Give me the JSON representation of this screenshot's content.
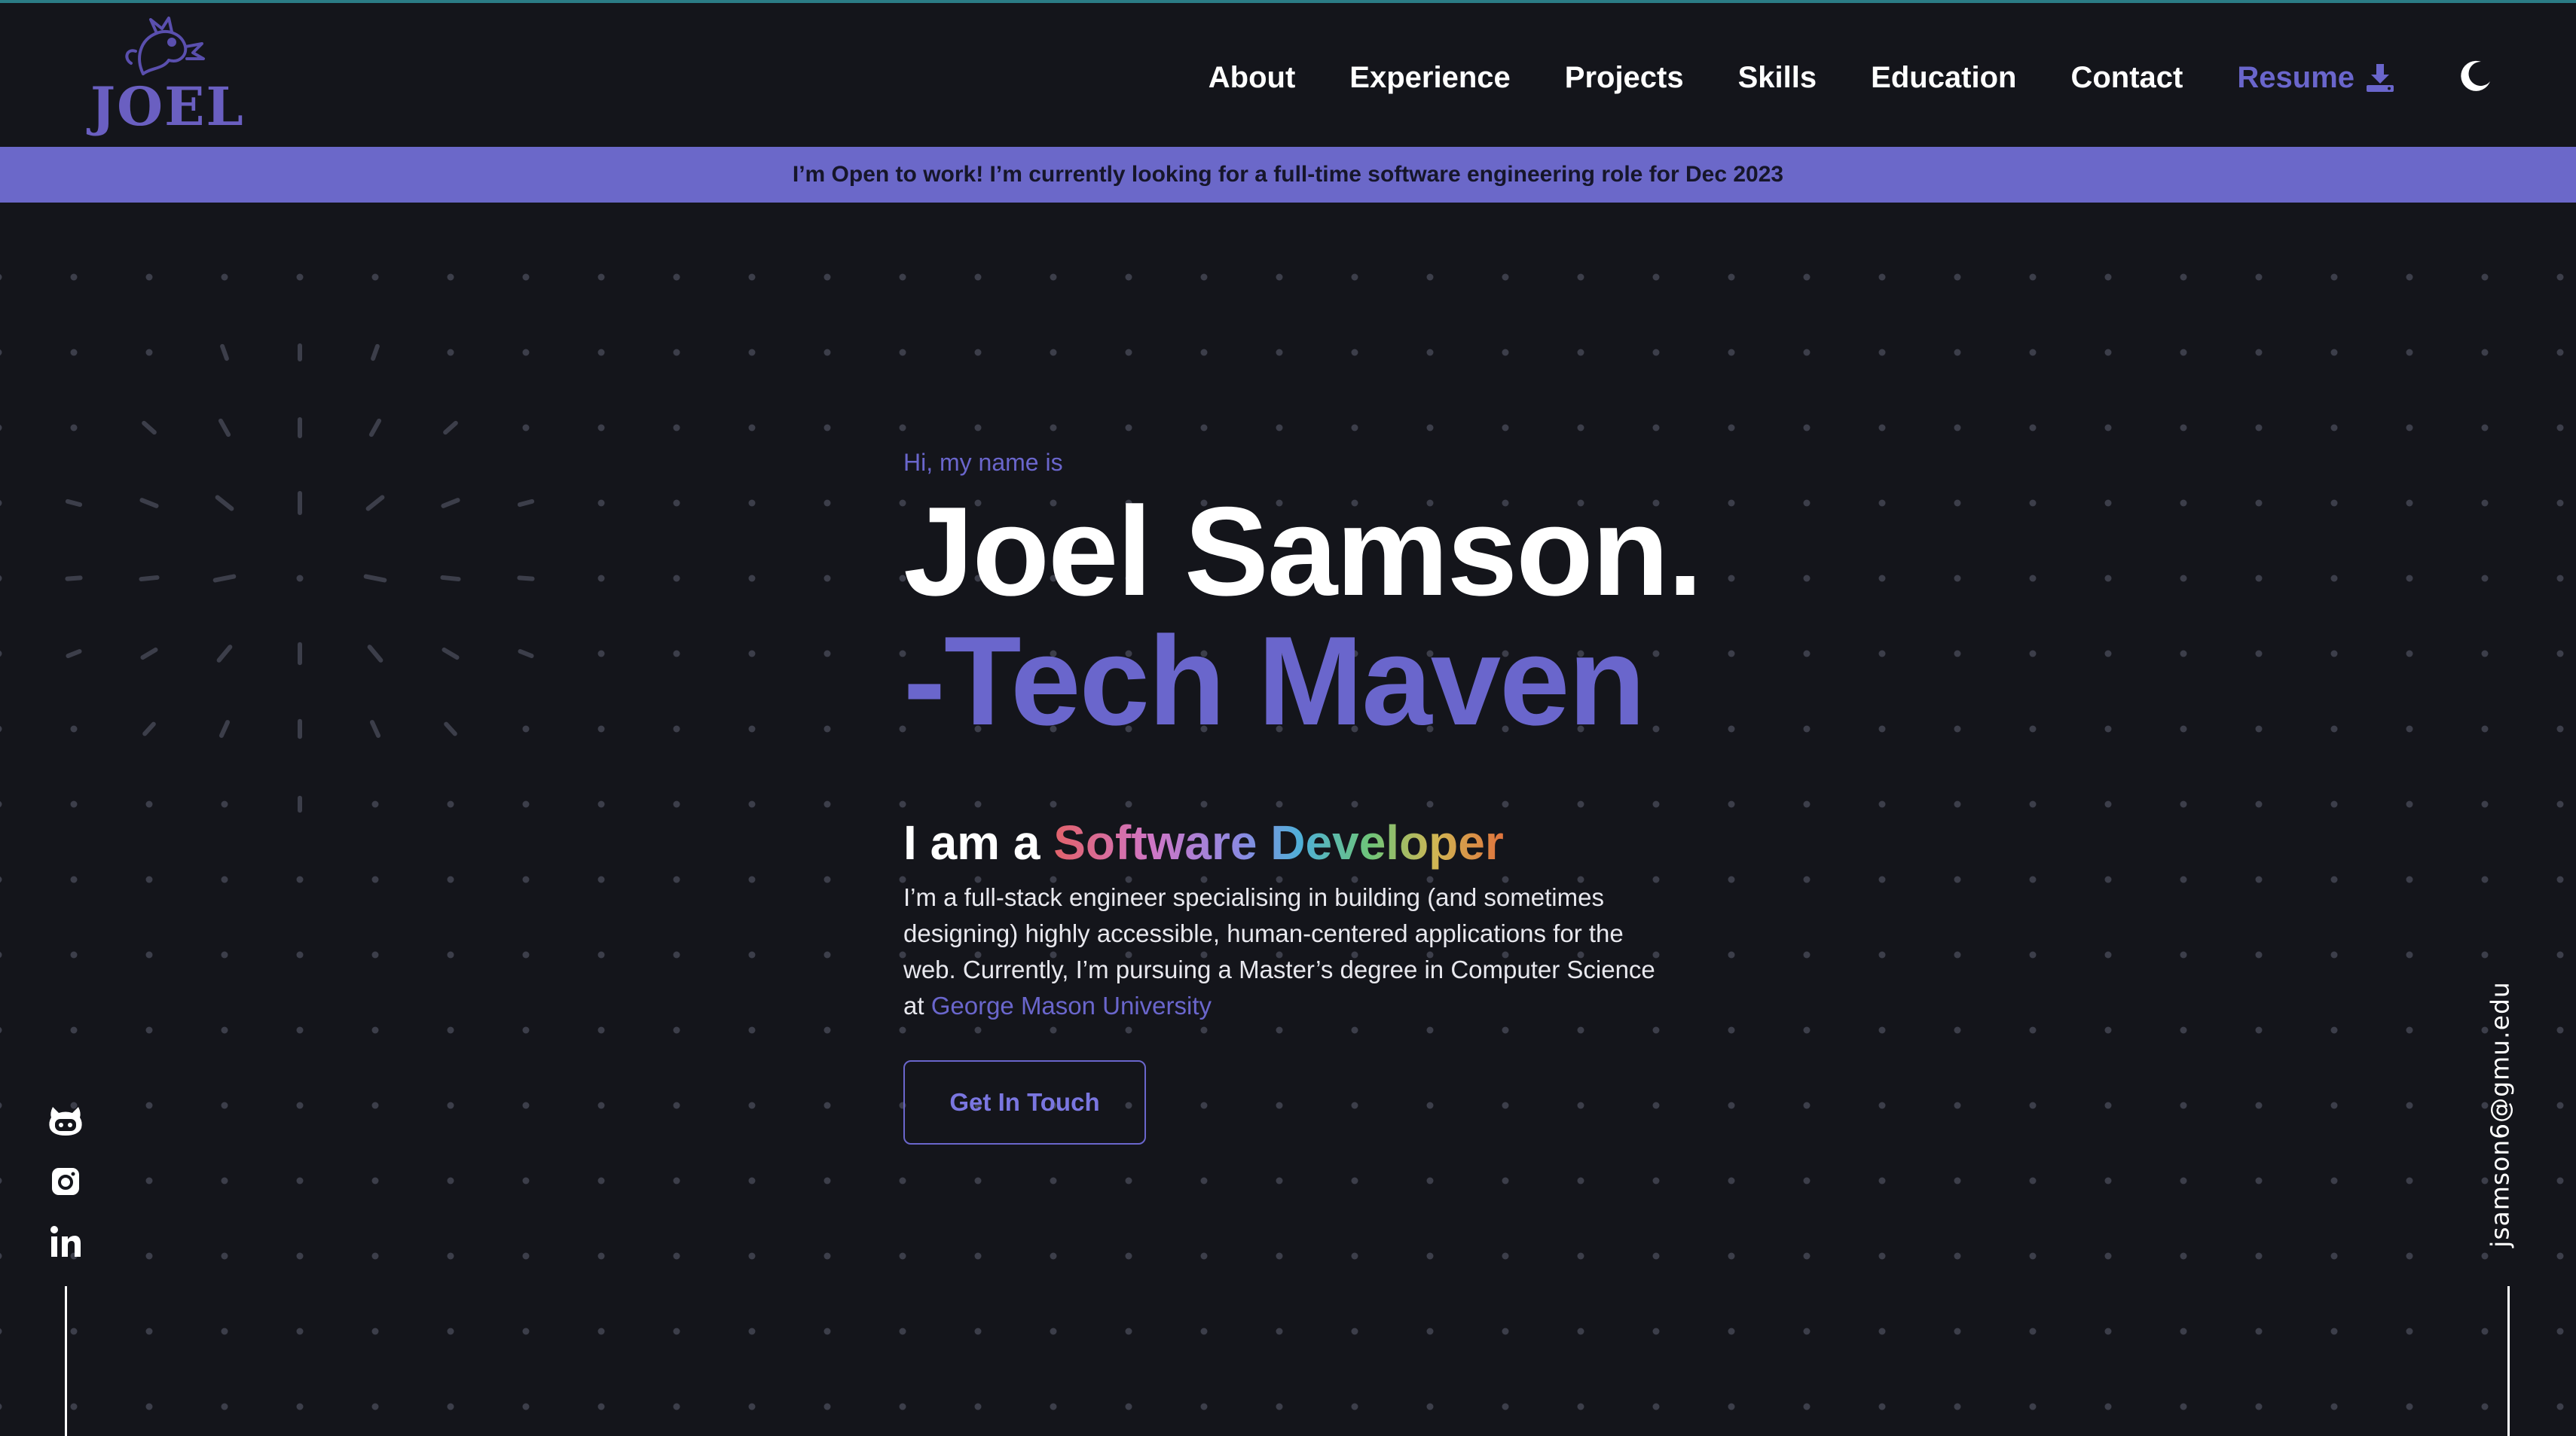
{
  "header": {
    "logo_text": "JOEL",
    "nav": [
      {
        "label": "About"
      },
      {
        "label": "Experience"
      },
      {
        "label": "Projects"
      },
      {
        "label": "Skills"
      },
      {
        "label": "Education"
      },
      {
        "label": "Contact"
      }
    ],
    "resume_label": "Resume",
    "resume_icon": "download-icon",
    "theme_toggle_icon": "moon-icon"
  },
  "banner": {
    "text": "I’m Open to work! I’m currently looking for a full-time software engineering role for Dec 2023"
  },
  "hero": {
    "greeting": "Hi, my name is",
    "name": "Joel Samson.",
    "tagline": "-Tech Maven",
    "role_prefix": "I am a ",
    "role_highlight": "Software Developer",
    "description": "I’m a full-stack engineer specialising in building (and sometimes designing) highly accessible, human-centered applications for the web. Currently, I’m pursuing a Master’s degree in Computer Science at ",
    "university": "George Mason University",
    "cta_label": "Get In Touch"
  },
  "socials": [
    {
      "icon": "github-icon"
    },
    {
      "icon": "instagram-icon"
    },
    {
      "icon": "linkedin-icon"
    }
  ],
  "email": "jsamson6@gmu.edu",
  "colors": {
    "background": "#14151b",
    "accent": "#6a66cc",
    "banner": "#6b68c9",
    "dots": "#3c3e4a"
  }
}
